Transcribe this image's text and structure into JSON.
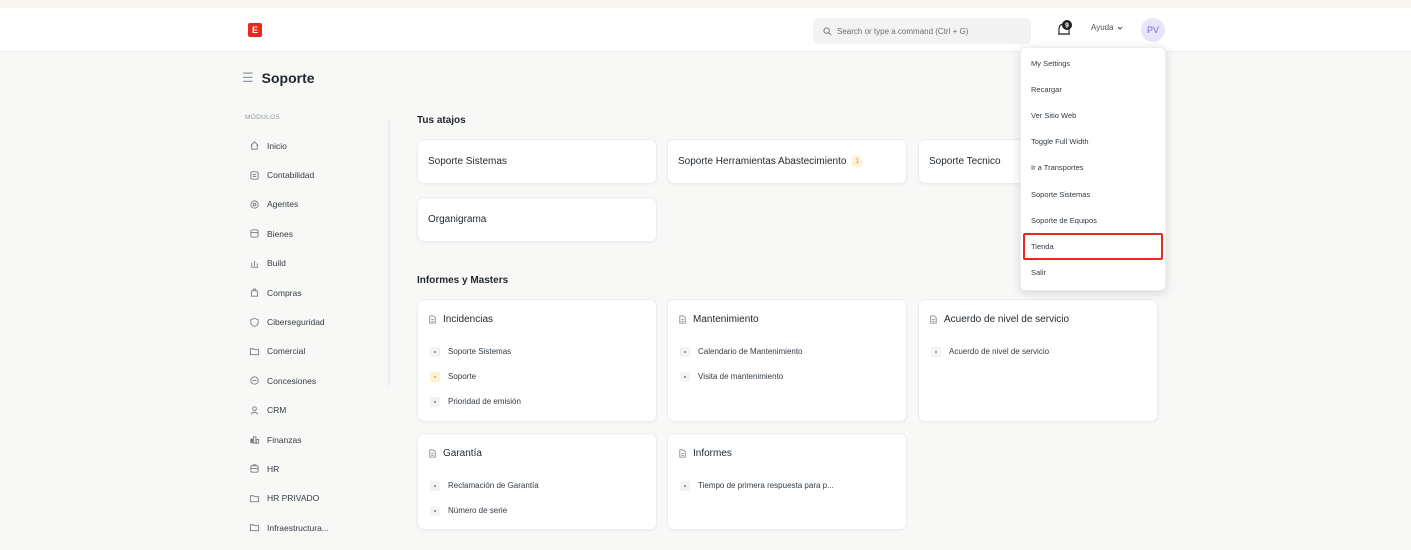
{
  "navbar": {
    "logo_letter": "E",
    "search_placeholder": "Search or type a command (Ctrl + G)",
    "notification_count": "9",
    "help_label": "Ayuda",
    "avatar_initials": "PV"
  },
  "page": {
    "title": "Soporte"
  },
  "sidebar": {
    "section_label": "MÓDULOS",
    "items": [
      {
        "label": "Inicio",
        "icon": "home-icon"
      },
      {
        "label": "Contabilidad",
        "icon": "accounting-icon"
      },
      {
        "label": "Agentes",
        "icon": "agents-icon"
      },
      {
        "label": "Bienes",
        "icon": "assets-icon"
      },
      {
        "label": "Build",
        "icon": "build-icon"
      },
      {
        "label": "Compras",
        "icon": "purchases-icon"
      },
      {
        "label": "Ciberseguridad",
        "icon": "shield-icon"
      },
      {
        "label": "Comercial",
        "icon": "folder-icon"
      },
      {
        "label": "Concesiones",
        "icon": "concessions-icon"
      },
      {
        "label": "CRM",
        "icon": "crm-icon"
      },
      {
        "label": "Finanzas",
        "icon": "finance-icon"
      },
      {
        "label": "HR",
        "icon": "hr-icon"
      },
      {
        "label": "HR PRIVADO",
        "icon": "folder-icon"
      },
      {
        "label": "Infraestructura...",
        "icon": "folder-icon"
      }
    ]
  },
  "shortcuts": {
    "title": "Tus atajos",
    "items": [
      {
        "label": "Soporte Sistemas",
        "count": ""
      },
      {
        "label": "Soporte Herramientas Abastecimiento",
        "count": "1"
      },
      {
        "label": "Soporte Tecnico",
        "count": ""
      },
      {
        "label": "Organigrama",
        "count": ""
      }
    ]
  },
  "reports": {
    "title": "Informes y Masters",
    "cards": [
      {
        "title": "Incidencias",
        "links": [
          {
            "label": "Soporte Sistemas",
            "highlight": false
          },
          {
            "label": "Soporte",
            "highlight": true
          },
          {
            "label": "Prioridad de emisión",
            "highlight": false
          }
        ]
      },
      {
        "title": "Mantenimiento",
        "links": [
          {
            "label": "Calendario de Mantenimiento",
            "highlight": false
          },
          {
            "label": "Visita de mantenimiento",
            "highlight": false
          }
        ]
      },
      {
        "title": "Acuerdo de nivel de servicio",
        "links": [
          {
            "label": "Acuerdo de nivel de servicio",
            "highlight": false
          }
        ]
      },
      {
        "title": "Garantía",
        "links": [
          {
            "label": "Reclamación de Garantía",
            "highlight": false
          },
          {
            "label": "Número de serie",
            "highlight": false
          }
        ]
      },
      {
        "title": "Informes",
        "links": [
          {
            "label": "Tiempo de primera respuesta para p...",
            "highlight": false
          }
        ]
      }
    ]
  },
  "user_menu": {
    "items": [
      {
        "label": "My Settings",
        "highlighted": false
      },
      {
        "label": "Recargar",
        "highlighted": false
      },
      {
        "label": "Ver Sitio Web",
        "highlighted": false
      },
      {
        "label": "Toggle Full Width",
        "highlighted": false
      },
      {
        "label": "Ir a Transportes",
        "highlighted": false
      },
      {
        "label": "Soporte Sistemas",
        "highlighted": false
      },
      {
        "label": "Soporte de Equipos",
        "highlighted": false
      },
      {
        "label": "Tienda",
        "highlighted": true
      },
      {
        "label": "Salir",
        "highlighted": false
      }
    ]
  },
  "colors": {
    "brand": "#e8291c",
    "accent_orange": "#e59d2a",
    "avatar_bg": "#e9e4fb",
    "highlight_outline": "#e8291c"
  }
}
